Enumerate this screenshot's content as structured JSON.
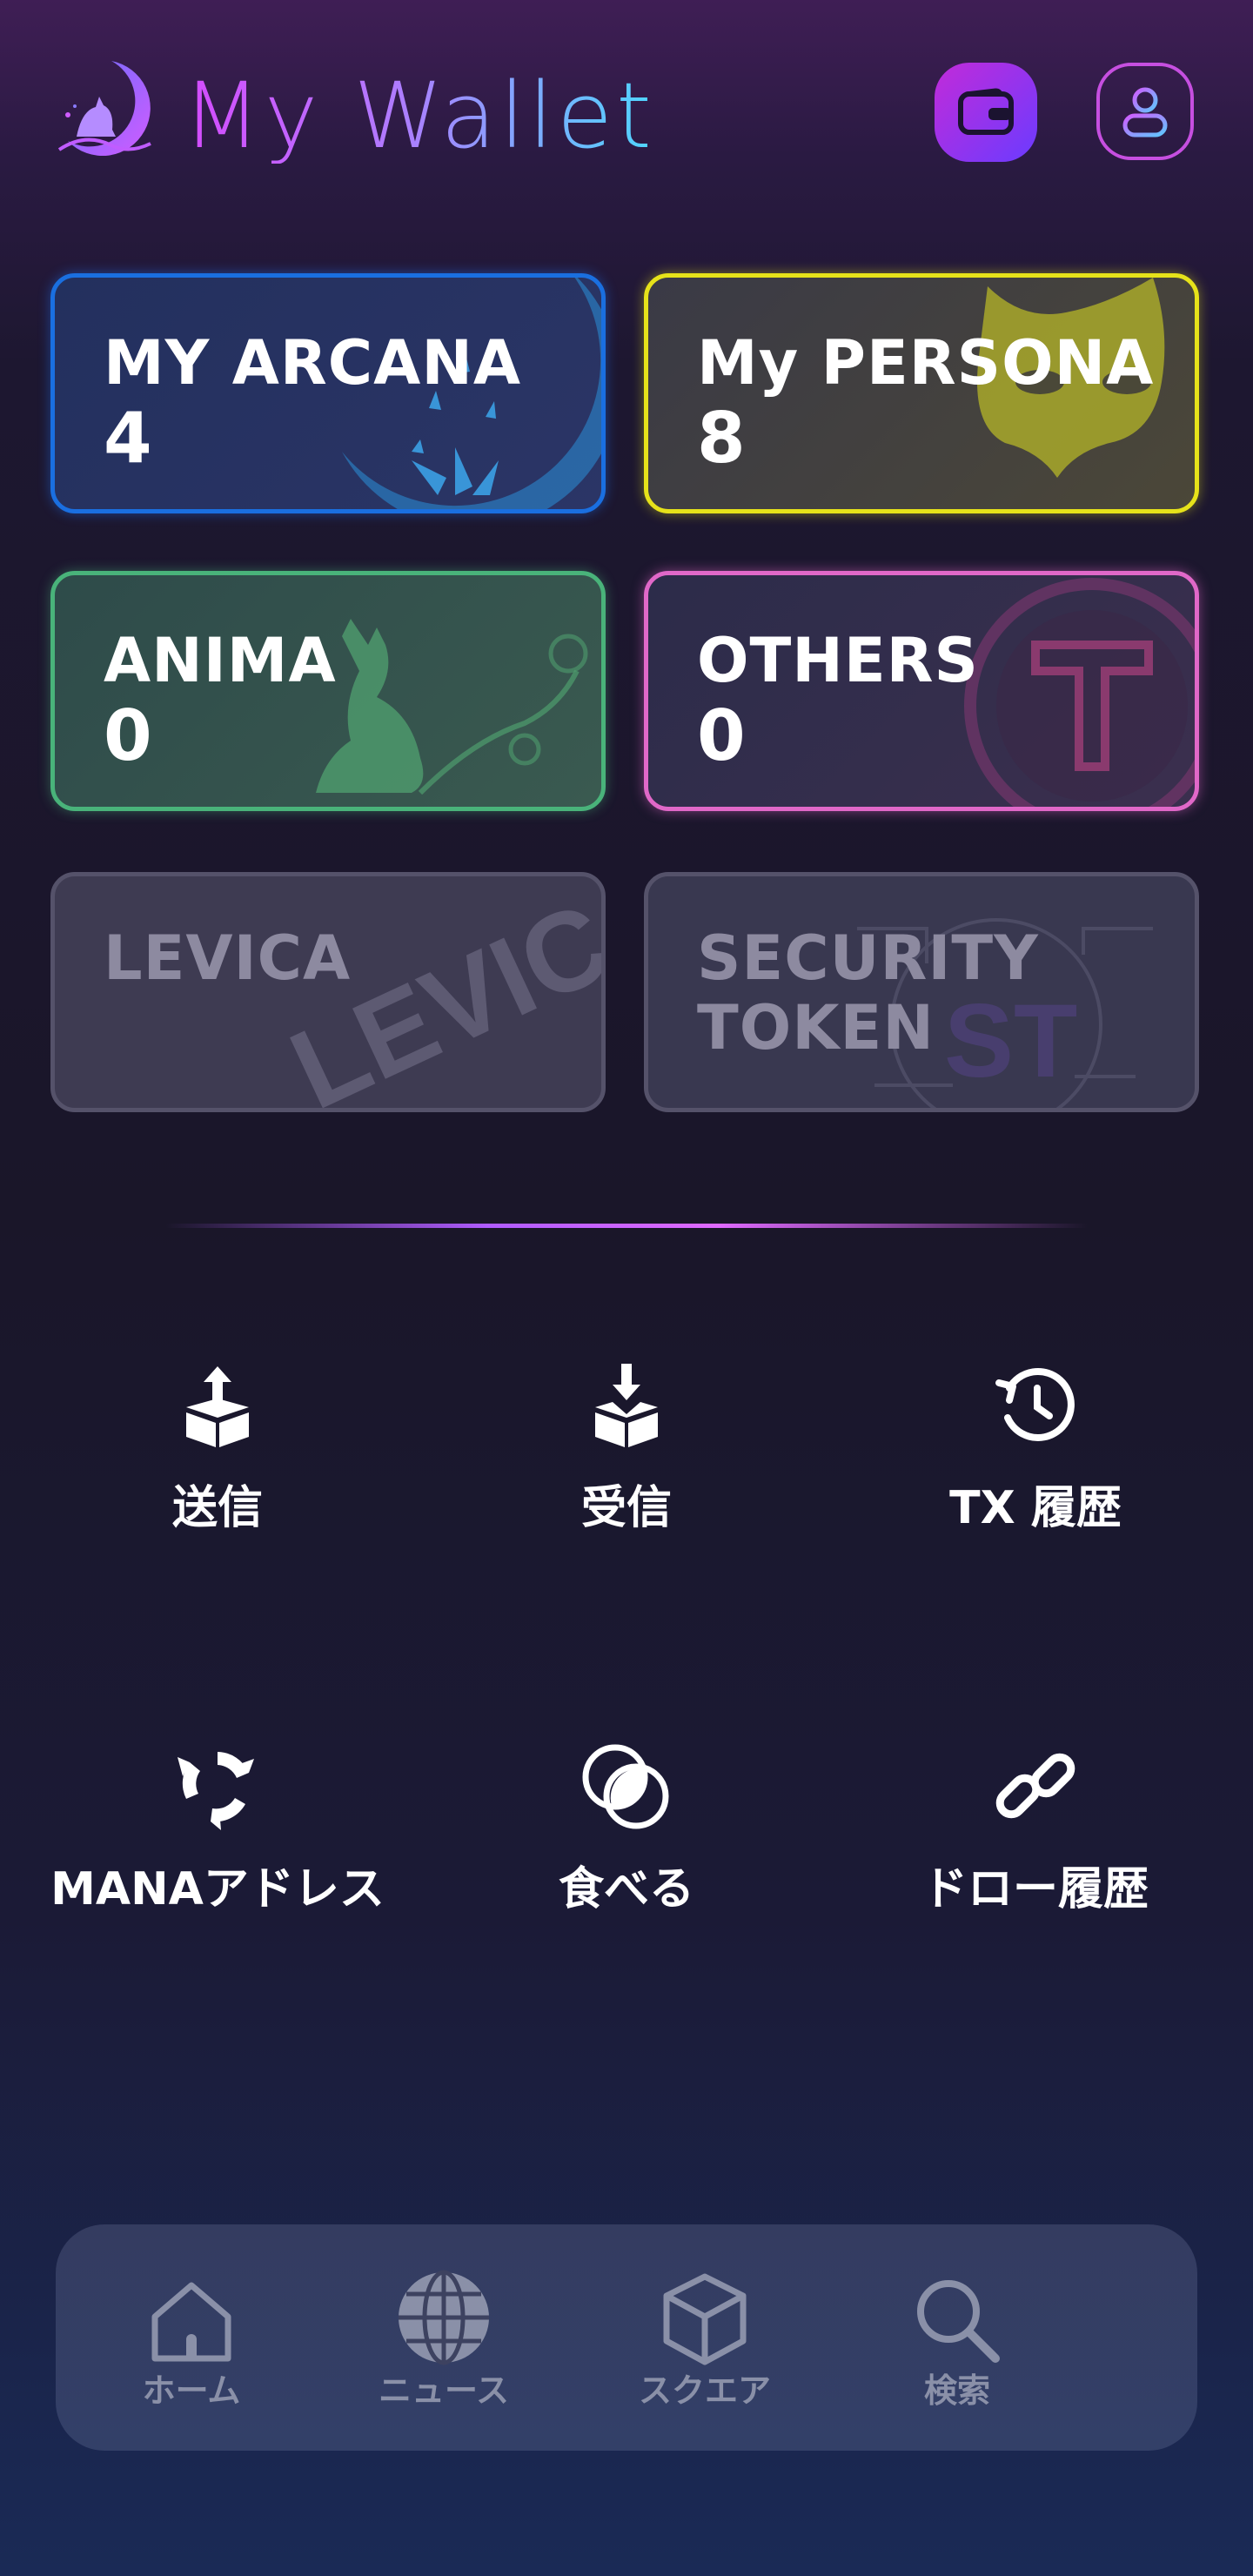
{
  "header": {
    "title": "My Wallet",
    "wallet_icon": "wallet-icon",
    "profile_icon": "user-icon",
    "accent_colors": [
      "#d54bff",
      "#4fd6ff"
    ]
  },
  "cards": [
    {
      "label": "MY ARCANA",
      "count": "4",
      "color": "#1a6fe0"
    },
    {
      "label": "My PERSONA",
      "count": "8",
      "color": "#e6e21a"
    },
    {
      "label": "ANIMA",
      "count": "0",
      "color": "#49b37a"
    },
    {
      "label": "OTHERS",
      "count": "0",
      "color": "#e068c8"
    },
    {
      "label": "LEVICA",
      "count": "",
      "color": "#55526a",
      "watermark": "LEVICA"
    },
    {
      "label": "SECURITY TOKEN",
      "count": "",
      "color": "#55526a",
      "watermark": "ST"
    }
  ],
  "actions": [
    {
      "label": "送信",
      "icon": "send-box-icon"
    },
    {
      "label": "受信",
      "icon": "receive-box-icon"
    },
    {
      "label": "TX 履歴",
      "icon": "history-icon"
    },
    {
      "label": "MANAアドレス",
      "icon": "recycle-icon"
    },
    {
      "label": "食べる",
      "icon": "overlap-circles-icon"
    },
    {
      "label": "ドロー履歴",
      "icon": "link-icon"
    }
  ],
  "bottom_nav": [
    {
      "label": "ホーム",
      "icon": "home-icon"
    },
    {
      "label": "ニュース",
      "icon": "globe-icon"
    },
    {
      "label": "スクエア",
      "icon": "cube-icon"
    },
    {
      "label": "検索",
      "icon": "search-icon"
    }
  ]
}
